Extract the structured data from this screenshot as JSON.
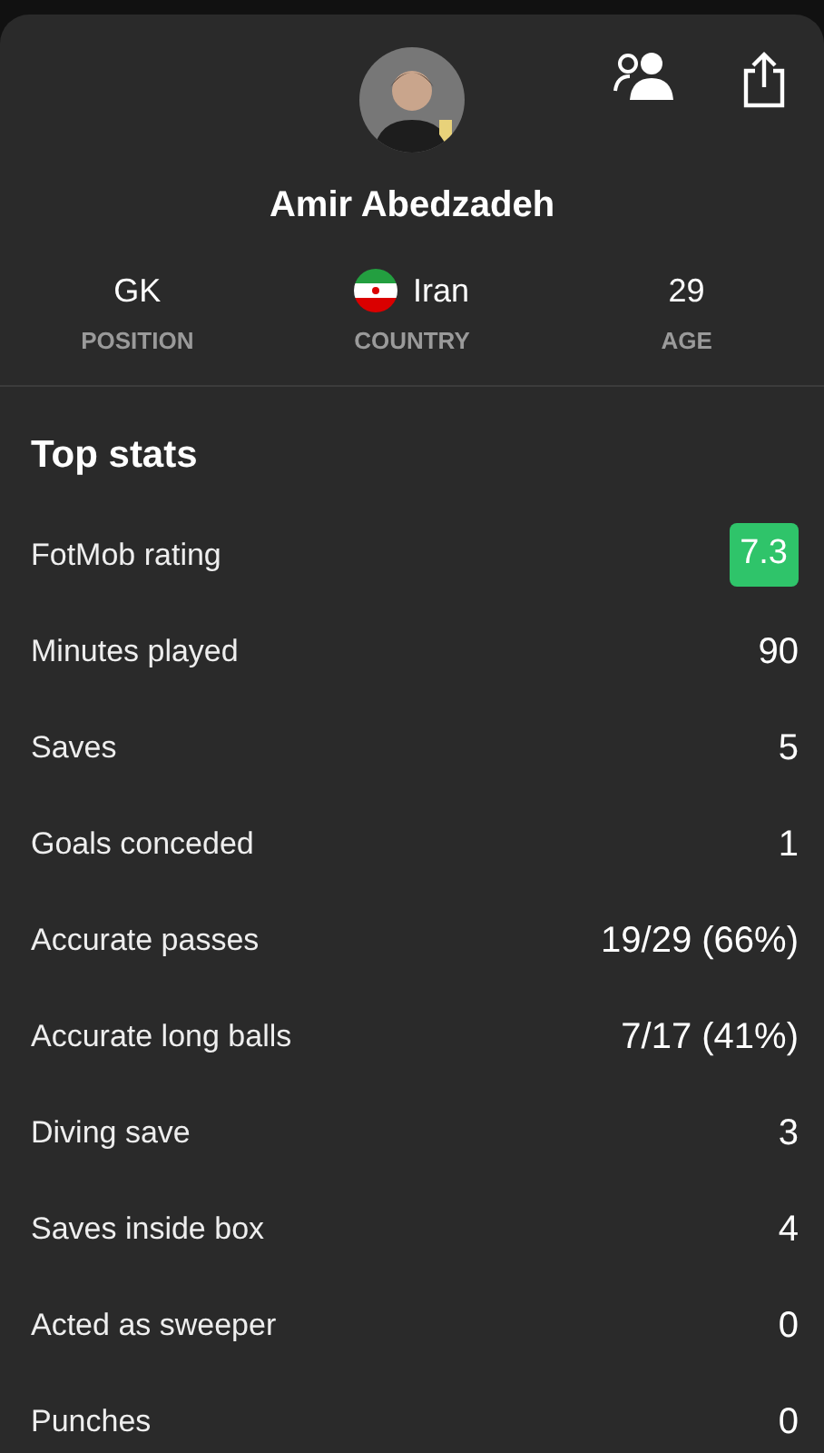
{
  "player": {
    "name": "Amir Abedzadeh"
  },
  "info": [
    {
      "kind": "text",
      "value": "GK",
      "label": "POSITION"
    },
    {
      "kind": "flag",
      "value": "Iran",
      "label": "COUNTRY"
    },
    {
      "kind": "text",
      "value": "29",
      "label": "AGE"
    }
  ],
  "top_stats": {
    "title": "Top stats",
    "rows": [
      {
        "kind": "rating",
        "label": "FotMob rating",
        "value": "7.3",
        "color": "#2fc46a"
      },
      {
        "kind": "text",
        "label": "Minutes played",
        "value": "90"
      },
      {
        "kind": "text",
        "label": "Saves",
        "value": "5"
      },
      {
        "kind": "text",
        "label": "Goals conceded",
        "value": "1"
      },
      {
        "kind": "text",
        "label": "Accurate passes",
        "value": "19/29 (66%)"
      },
      {
        "kind": "text",
        "label": "Accurate long balls",
        "value": "7/17 (41%)"
      },
      {
        "kind": "text",
        "label": "Diving save",
        "value": "3"
      },
      {
        "kind": "text",
        "label": "Saves inside box",
        "value": "4"
      },
      {
        "kind": "text",
        "label": "Acted as sweeper",
        "value": "0"
      },
      {
        "kind": "text",
        "label": "Punches",
        "value": "0"
      }
    ]
  }
}
